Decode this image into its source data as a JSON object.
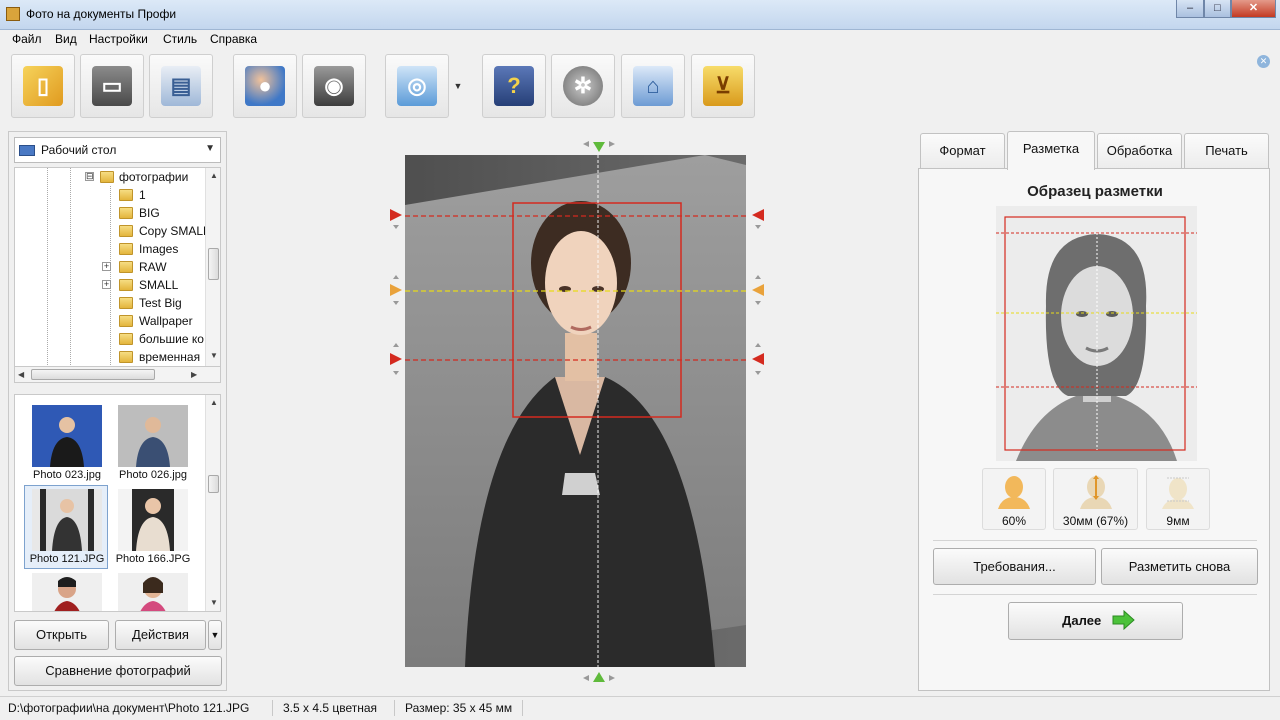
{
  "window": {
    "title": "Фото на документы Профи",
    "min": "–",
    "max": "□",
    "close": "✕"
  },
  "menu": [
    "Файл",
    "Вид",
    "Настройки",
    "Стиль",
    "Справка"
  ],
  "toolbar": {
    "buttons": [
      {
        "name": "open-icon",
        "glyph": "▯"
      },
      {
        "name": "save-icon",
        "glyph": "▭"
      },
      {
        "name": "print-icon",
        "glyph": "▤"
      },
      {
        "name": "contacts-search-icon",
        "glyph": "●"
      },
      {
        "name": "camera-icon",
        "glyph": "◉"
      },
      {
        "name": "image-zoom-icon",
        "glyph": "◎"
      },
      {
        "name": "help-book-icon",
        "glyph": "?"
      },
      {
        "name": "film-reel-icon",
        "glyph": "✲"
      },
      {
        "name": "home-icon",
        "glyph": "⌂"
      },
      {
        "name": "shopping-cart-icon",
        "glyph": "⊻"
      }
    ],
    "dropdown": "▼",
    "close": "✕"
  },
  "left": {
    "drive": {
      "label": "Рабочий стол",
      "arrow": "▼"
    },
    "tree": {
      "root": {
        "label": "фотографии",
        "expander": "⊟"
      },
      "children": [
        {
          "label": "1",
          "expander": ""
        },
        {
          "label": "BIG",
          "expander": ""
        },
        {
          "label": "Copy SMALL",
          "expander": ""
        },
        {
          "label": "Images",
          "expander": ""
        },
        {
          "label": "RAW",
          "expander": "+"
        },
        {
          "label": "SMALL",
          "expander": "+"
        },
        {
          "label": "Test Big",
          "expander": ""
        },
        {
          "label": "Wallpaper",
          "expander": ""
        },
        {
          "label": "большие ко",
          "expander": ""
        },
        {
          "label": "временная",
          "expander": ""
        }
      ],
      "up": "▲",
      "down": "▼",
      "left": "◀",
      "right": "▶"
    },
    "thumbnails": [
      {
        "caption": "Photo 023.jpg",
        "bg": "#2f59b5",
        "selected": false
      },
      {
        "caption": "Photo 026.jpg",
        "bg": "#bdbdbd",
        "selected": false
      },
      {
        "caption": "Photo 121.JPG",
        "bg": "#e8e8e8",
        "selected": true
      },
      {
        "caption": "Photo 166.JPG",
        "bg": "#f3f3f3",
        "selected": false
      },
      {
        "caption": "",
        "bg": "#efefef",
        "selected": false
      },
      {
        "caption": "",
        "bg": "#efefef",
        "selected": false
      }
    ],
    "thumbs_scroll": {
      "up": "▲",
      "down": "▼"
    },
    "buttons": {
      "open": "Открыть",
      "actions": "Действия",
      "actions_arrow": "▼",
      "compare": "Сравнение фотографий"
    }
  },
  "tabs": [
    {
      "label": "Формат",
      "active": false
    },
    {
      "label": "Разметка",
      "active": true
    },
    {
      "label": "Обработка",
      "active": false
    },
    {
      "label": "Печать",
      "active": false
    }
  ],
  "right": {
    "title": "Образец разметки",
    "measures": [
      {
        "label": "60%",
        "icon": "head-size-icon"
      },
      {
        "label": "30мм (67%)",
        "icon": "face-height-icon"
      },
      {
        "label": "9мм",
        "icon": "top-margin-icon"
      }
    ],
    "requirements": "Требования...",
    "remark": "Разметить снова",
    "next": "Далее"
  },
  "status": {
    "path": "D:\\фотографии\\на документ\\Photo 121.JPG",
    "format": "3.5 x 4.5 цветная",
    "size": "Размер: 35 x 45 мм"
  },
  "colors": {
    "guide_red": "#d42a1f",
    "guide_yellow": "#e0d21a",
    "guide_green": "#4fb43a",
    "accent": "#3c7fd1"
  }
}
